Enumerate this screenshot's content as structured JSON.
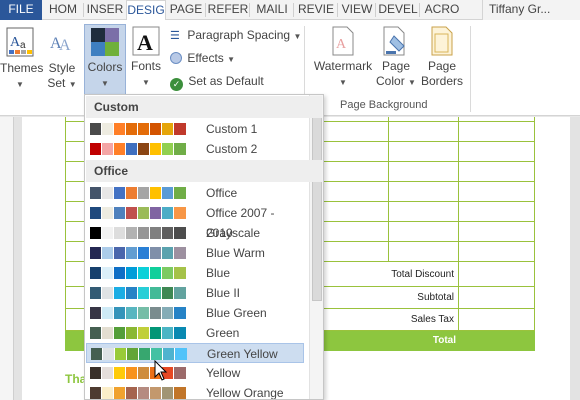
{
  "tabs": [
    {
      "label": "FILE",
      "cls": "file"
    },
    {
      "label": "HOM"
    },
    {
      "label": "INSER"
    },
    {
      "label": "DESIG",
      "active": true
    },
    {
      "label": "PAGE"
    },
    {
      "label": "REFER"
    },
    {
      "label": "MAILI"
    },
    {
      "label": "REVIE"
    },
    {
      "label": "VIEW"
    },
    {
      "label": "DEVEL"
    },
    {
      "label": "ACRO"
    }
  ],
  "user": "Tiffany Gr...",
  "ribbon": {
    "themes": "Themes",
    "style_set_1": "Style",
    "style_set_2": "Set",
    "colors": "Colors",
    "fonts": "Fonts",
    "paragraph_spacing": "Paragraph Spacing",
    "effects": "Effects",
    "set_as_default": "Set as Default",
    "watermark": "Watermark",
    "page_color_1": "Page",
    "page_color_2": "Color",
    "page_borders_1": "Page",
    "page_borders_2": "Borders",
    "page_background_group": "Page Background"
  },
  "document": {
    "total_discount": "Total Discount",
    "subtotal": "Subtotal",
    "sales_tax": "Sales Tax",
    "total": "Total",
    "thanks": "Tha"
  },
  "dropdown": {
    "custom_header": "Custom",
    "office_header": "Office",
    "custom_themes": [
      {
        "name": "Custom 1",
        "colors": [
          "#4a4a4a",
          "#eeece1",
          "#ff7f27",
          "#e36c09",
          "#e36c09",
          "#d35400",
          "#e5a50a",
          "#c0392b"
        ]
      },
      {
        "name": "Custom 2",
        "colors": [
          "#c00000",
          "#f4a6a6",
          "#ff7f27",
          "#3f6fbf",
          "#8b4513",
          "#ffc000",
          "#92d050",
          "#70ad47"
        ]
      }
    ],
    "office_themes": [
      {
        "name": "Office",
        "colors": [
          "#44546a",
          "#e7e6e6",
          "#4472c4",
          "#ed7d31",
          "#a5a5a5",
          "#ffc000",
          "#5b9bd5",
          "#70ad47"
        ]
      },
      {
        "name": "Office 2007 - 2010",
        "colors": [
          "#1f497d",
          "#eeece1",
          "#4f81bd",
          "#c0504d",
          "#9bbb59",
          "#8064a2",
          "#4bacc6",
          "#f79646"
        ]
      },
      {
        "name": "Grayscale",
        "colors": [
          "#000000",
          "#f2f2f2",
          "#dddddd",
          "#b2b2b2",
          "#969696",
          "#808080",
          "#5f5f5f",
          "#4d4d4d"
        ]
      },
      {
        "name": "Blue Warm",
        "colors": [
          "#242852",
          "#acccea",
          "#4a66ac",
          "#629dd1",
          "#297fd5",
          "#7f8fa9",
          "#5aa2ae",
          "#9d90a0"
        ]
      },
      {
        "name": "Blue",
        "colors": [
          "#17406d",
          "#dbeff9",
          "#0f6fc6",
          "#009dd9",
          "#0bd0d9",
          "#10cf9b",
          "#7cca62",
          "#a5c249"
        ]
      },
      {
        "name": "Blue II",
        "colors": [
          "#335b74",
          "#dfe3e5",
          "#1cade4",
          "#2683c6",
          "#27ced7",
          "#42ba97",
          "#3e8853",
          "#62a39f"
        ]
      },
      {
        "name": "Blue Green",
        "colors": [
          "#373545",
          "#ceeaf6",
          "#3494ba",
          "#58b6c0",
          "#75bda7",
          "#7a8c8e",
          "#84acb6",
          "#2683c6"
        ]
      },
      {
        "name": "Green",
        "colors": [
          "#455f51",
          "#e3ded1",
          "#549e39",
          "#8ab833",
          "#c0cf3a",
          "#029676",
          "#4ab5c4",
          "#0989b1"
        ]
      },
      {
        "name": "Green Yellow",
        "colors": [
          "#455f51",
          "#dfe3e5",
          "#99cb38",
          "#63a537",
          "#37a76f",
          "#44c1a3",
          "#4eb3cf",
          "#51c3f9"
        ],
        "highlight": true
      },
      {
        "name": "Yellow",
        "colors": [
          "#39302a",
          "#e5dedb",
          "#ffca08",
          "#f8931d",
          "#ce8d3e",
          "#ec7016",
          "#e64823",
          "#9c6a6a"
        ]
      },
      {
        "name": "Yellow Orange",
        "colors": [
          "#4e3b30",
          "#fbeec9",
          "#f0a22e",
          "#a5644e",
          "#b58b80",
          "#c3986d",
          "#a19574",
          "#c17529"
        ]
      }
    ]
  },
  "colors": {
    "accent": "#2b579a",
    "green": "#8dc63f"
  }
}
